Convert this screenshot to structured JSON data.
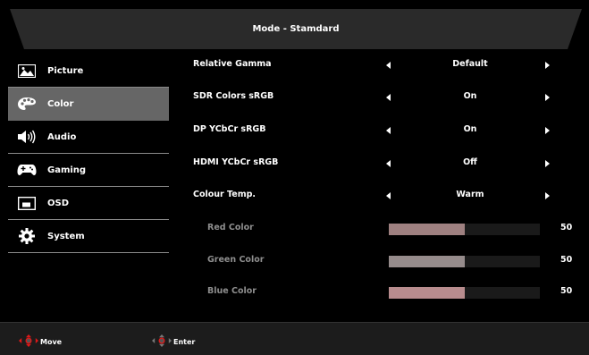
{
  "header": {
    "title": "Mode - Stamdard"
  },
  "sidebar": {
    "items": [
      {
        "label": "Picture",
        "icon": "picture-icon",
        "selected": false
      },
      {
        "label": "Color",
        "icon": "palette-icon",
        "selected": true
      },
      {
        "label": "Audio",
        "icon": "speaker-icon",
        "selected": false
      },
      {
        "label": "Gaming",
        "icon": "gamepad-icon",
        "selected": false
      },
      {
        "label": "OSD",
        "icon": "osd-window-icon",
        "selected": false
      },
      {
        "label": "System",
        "icon": "gear-icon",
        "selected": false
      }
    ]
  },
  "settings": [
    {
      "label": "Relative Gamma",
      "value": "Default"
    },
    {
      "label": "SDR Colors sRGB",
      "value": "On"
    },
    {
      "label": "DP YCbCr sRGB",
      "value": "On"
    },
    {
      "label": "HDMI YCbCr sRGB",
      "value": "Off"
    },
    {
      "label": "Colour Temp.",
      "value": "Warm"
    }
  ],
  "sliders": [
    {
      "label": "Red Color",
      "value": "50",
      "fill_fraction": 0.5,
      "fill_color": "#9e8080"
    },
    {
      "label": "Green Color",
      "value": "50",
      "fill_fraction": 0.5,
      "fill_color": "#968c8c"
    },
    {
      "label": "Blue Color",
      "value": "50",
      "fill_fraction": 0.5,
      "fill_color": "#b88c8e"
    }
  ],
  "footer": {
    "move_label": "Move",
    "enter_label": "Enter"
  },
  "colors": {
    "accent_red": "#e01818",
    "selected_bg": "#666666"
  }
}
